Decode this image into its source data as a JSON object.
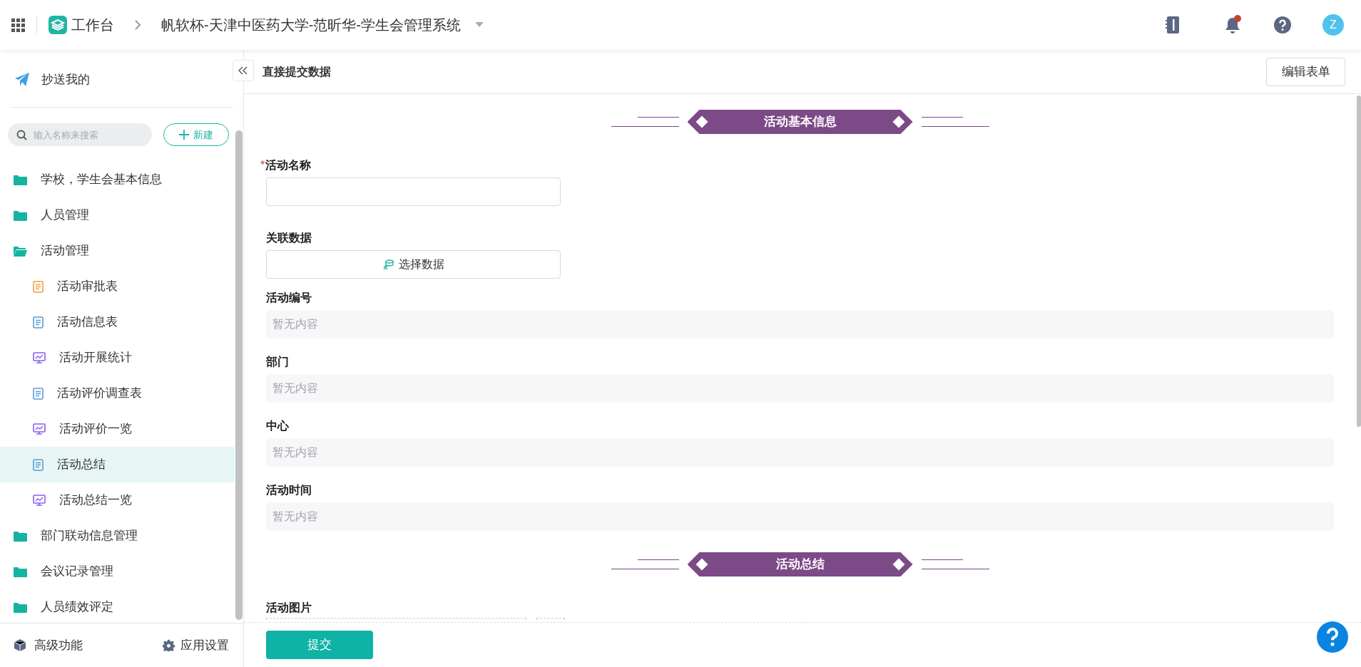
{
  "top_bar": {
    "workspace": "工作台",
    "app_title": "帆软杯-天津中医药大学-范昕华-学生会管理系统",
    "avatar": "Z",
    "notification_dot": true
  },
  "sidebar": {
    "cc_item": "抄送我的",
    "search": {
      "placeholder": "输入名称来搜索"
    },
    "new_button": "新建",
    "items": [
      {
        "kind": "folder",
        "label": "学校，学生会基本信息",
        "expanded": false,
        "selected": false
      },
      {
        "kind": "folder",
        "label": "人员管理",
        "expanded": false,
        "selected": false
      },
      {
        "kind": "folder",
        "label": "活动管理",
        "expanded": true,
        "selected": false,
        "children": [
          {
            "kind": "flow",
            "label": "活动审批表",
            "selected": false
          },
          {
            "kind": "form",
            "label": "活动信息表",
            "selected": false
          },
          {
            "kind": "report",
            "label": "活动开展统计",
            "selected": false
          },
          {
            "kind": "form",
            "label": "活动评价调查表",
            "selected": false
          },
          {
            "kind": "report",
            "label": "活动评价一览",
            "selected": false
          },
          {
            "kind": "form",
            "label": "活动总结",
            "selected": true
          },
          {
            "kind": "report",
            "label": "活动总结一览",
            "selected": false
          }
        ]
      },
      {
        "kind": "folder",
        "label": "部门联动信息管理",
        "expanded": false,
        "selected": false
      },
      {
        "kind": "folder",
        "label": "会议记录管理",
        "expanded": false,
        "selected": false
      },
      {
        "kind": "folder",
        "label": "人员绩效评定",
        "expanded": false,
        "selected": false
      }
    ],
    "footer": {
      "advanced": "高级功能",
      "settings": "应用设置"
    }
  },
  "main": {
    "title": "直接提交数据",
    "edit_button": "编辑表单",
    "sections": [
      {
        "title": "活动基本信息",
        "fields": [
          {
            "kind": "input",
            "label": "活动名称",
            "required_mark": "*"
          },
          {
            "kind": "relation",
            "label": "关联数据",
            "button": "选择数据"
          },
          {
            "kind": "readonly",
            "label": "活动编号",
            "placeholder": "暂无内容"
          },
          {
            "kind": "readonly",
            "label": "部门",
            "placeholder": "暂无内容"
          },
          {
            "kind": "readonly",
            "label": "中心",
            "placeholder": "暂无内容"
          },
          {
            "kind": "readonly",
            "label": "活动时间",
            "placeholder": "暂无内容"
          }
        ]
      },
      {
        "title": "活动总结",
        "fields": [
          {
            "kind": "upload",
            "label": "活动图片"
          }
        ]
      }
    ],
    "submit_button": "提交"
  }
}
